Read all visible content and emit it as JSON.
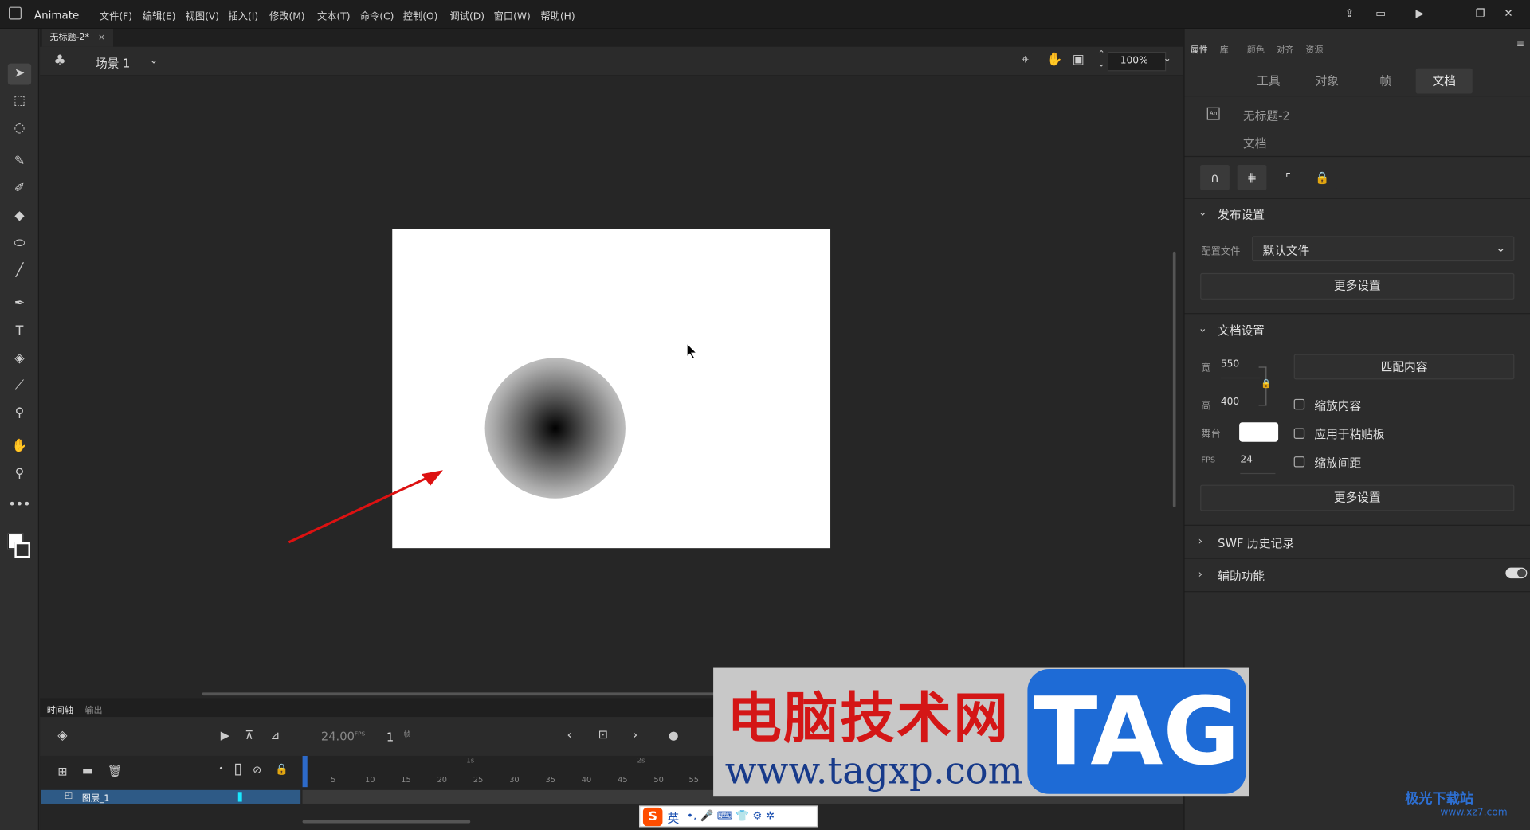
{
  "app": {
    "name": "Animate"
  },
  "menu": [
    "文件(F)",
    "编辑(E)",
    "视图(V)",
    "插入(I)",
    "修改(M)",
    "文本(T)",
    "命令(C)",
    "控制(O)",
    "调试(D)",
    "窗口(W)",
    "帮助(H)"
  ],
  "doc_tab": {
    "title": "无标题-2*",
    "close": "×"
  },
  "editbar": {
    "scene": "场景 1",
    "zoom": "100%"
  },
  "panel": {
    "tabs": [
      "属性",
      "库",
      "颜色",
      "对齐",
      "资源"
    ],
    "subtabs": [
      "工具",
      "对象",
      "帧",
      "文档"
    ],
    "doc_name": "无标题-2",
    "doc_type": "文档",
    "publish": {
      "title": "发布设置",
      "profile_label": "配置文件",
      "profile_value": "默认文件",
      "more": "更多设置"
    },
    "docsettings": {
      "title": "文档设置",
      "width_label": "宽",
      "width": "550",
      "height_label": "高",
      "height": "400",
      "match": "匹配内容",
      "stage_label": "舞台",
      "stage_color": "#ffffff",
      "fps_label": "FPS",
      "fps": "24",
      "scale_content": "缩放内容",
      "apply_paste": "应用于粘贴板",
      "scale_spacing": "缩放间距",
      "more": "更多设置"
    },
    "swf_history": "SWF 历史记录",
    "accessibility": "辅助功能"
  },
  "timeline": {
    "tabs": [
      "时间轴",
      "输出"
    ],
    "fps_display": "24.00",
    "fps_unit": "FPS",
    "frame_num": "1",
    "frame_unit": "帧",
    "layer_name": "图层_1",
    "ruler_secs": [
      "1s",
      "2s"
    ],
    "ruler": [
      "5",
      "10",
      "15",
      "20",
      "25",
      "30",
      "35",
      "40",
      "45",
      "50",
      "55"
    ]
  },
  "watermark": {
    "cn": "电脑技术网",
    "url": "www.tagxp.com",
    "tag": "TAG"
  },
  "ime": {
    "label": "英"
  },
  "site": {
    "name": "极光下载站",
    "url": "www.xz7.com"
  }
}
